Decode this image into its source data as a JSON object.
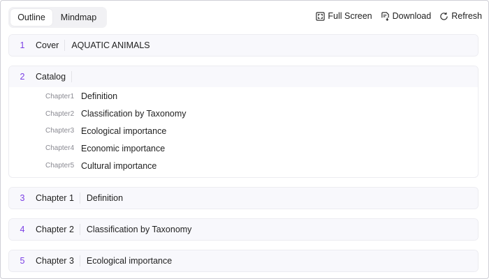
{
  "toolbar": {
    "tabs": {
      "outline": "Outline",
      "mindmap": "Mindmap"
    },
    "actions": {
      "full_screen": "Full Screen",
      "download": "Download",
      "refresh": "Refresh"
    }
  },
  "cards": [
    {
      "num": "1",
      "label": "Cover",
      "title": "AQUATIC ANIMALS"
    },
    {
      "num": "2",
      "label": "Catalog",
      "title": "",
      "items": [
        {
          "chapter": "Chapter1",
          "title": "Definition"
        },
        {
          "chapter": "Chapter2",
          "title": "Classification by Taxonomy"
        },
        {
          "chapter": "Chapter3",
          "title": "Ecological importance"
        },
        {
          "chapter": "Chapter4",
          "title": "Economic importance"
        },
        {
          "chapter": "Chapter5",
          "title": "Cultural importance"
        }
      ]
    },
    {
      "num": "3",
      "label": "Chapter 1",
      "title": "Definition"
    },
    {
      "num": "4",
      "label": "Chapter 2",
      "title": "Classification by Taxonomy"
    },
    {
      "num": "5",
      "label": "Chapter 3",
      "title": "Ecological importance"
    }
  ],
  "colors": {
    "accent": "#7b3fe4"
  }
}
